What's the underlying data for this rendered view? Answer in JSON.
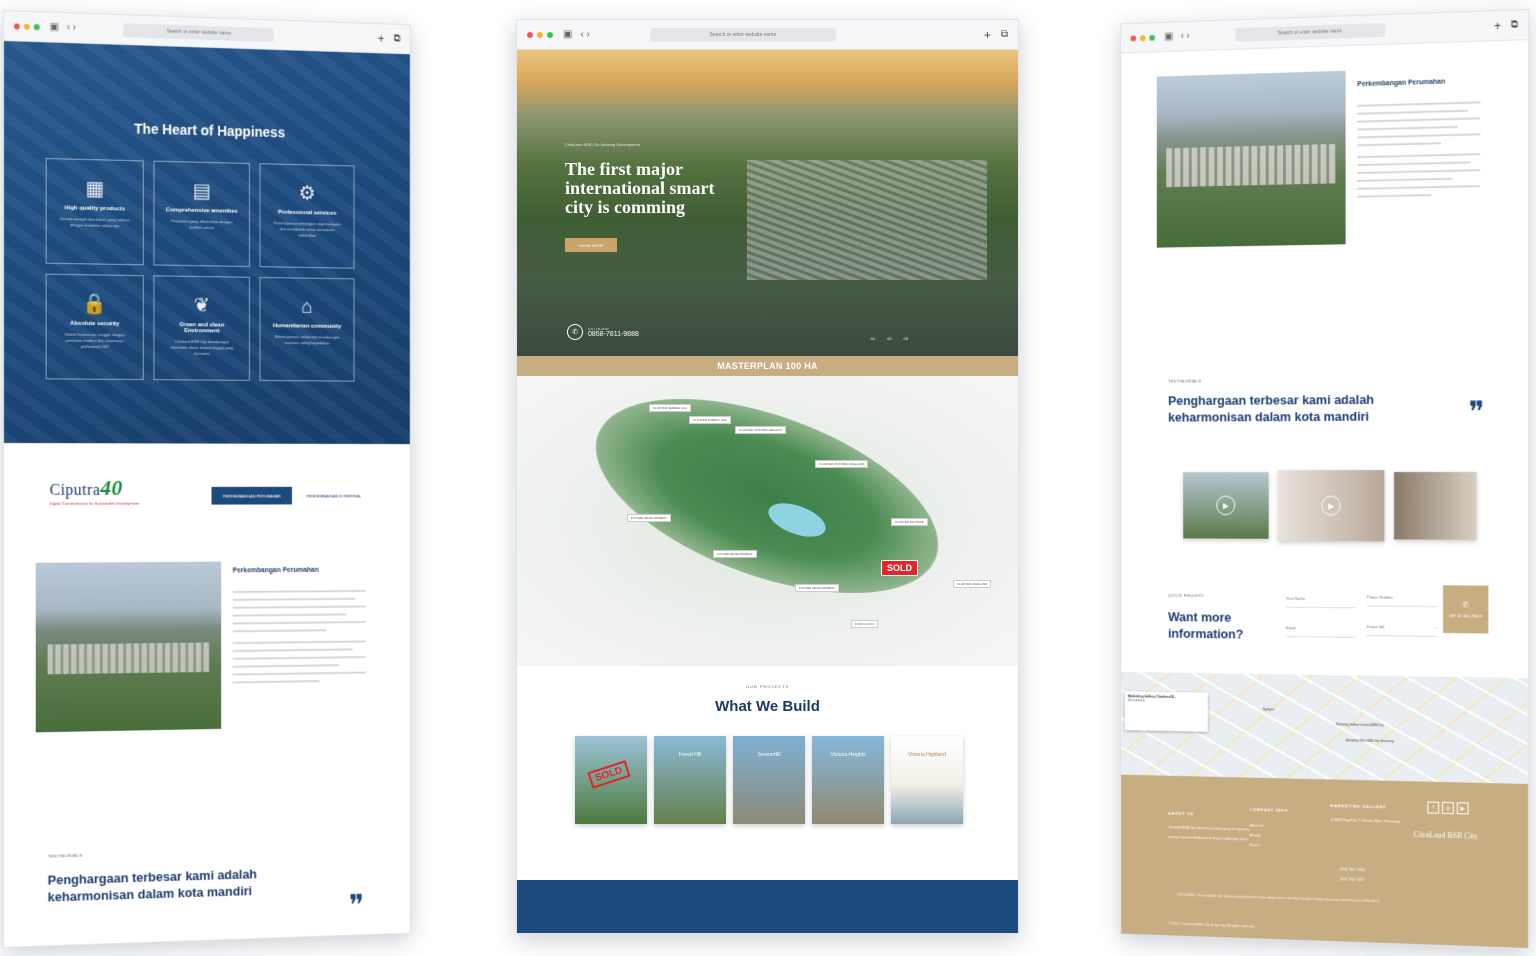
{
  "browser": {
    "url_placeholder": "Search or enter website name",
    "new_tab": "+",
    "copy": "⧉"
  },
  "left": {
    "hero_title": "The Heart of Happiness",
    "features": [
      {
        "icon": "building-icon",
        "glyph": "▦",
        "title": "High quality products",
        "desc": "Desain menarik dan kokoh yang selaras dengan arsitektur sekitarnya"
      },
      {
        "icon": "amenities-icon",
        "glyph": "▤",
        "title": "Comprehensive amenities",
        "desc": "Prasarana yang dibutuhkan dengan fasilitas umum"
      },
      {
        "icon": "service-icon",
        "glyph": "⚙",
        "title": "Professional services",
        "desc": "Pusat layanan pelanggan siap melayani dan membantu untuk memenuhi kebutuhan"
      },
      {
        "icon": "lock-icon",
        "glyph": "🔒",
        "title": "Absolute security",
        "desc": "Sistem keamanan canggih dengan peralatan modern dan keamanan profesional 24/7"
      },
      {
        "icon": "leaf-icon",
        "glyph": "❦",
        "title": "Green and clean Environment",
        "desc": "Citraland BSB City membangun ekosistem dasar tempat tinggal yang harmonis"
      },
      {
        "icon": "community-icon",
        "glyph": "⌂",
        "title": "Humanitarian community",
        "desc": "Keberagaman, solidaritas membangun suasana saling kepedulian"
      }
    ],
    "logo_text": "Ciputra",
    "logo_num": "40",
    "logo_tagline": "Digital Transformation for Sustainable Development",
    "tab_active": "PERKEMBANGAN PERUMAHAN",
    "tab_other": "PERKEMBANGAN KOMERSIAL",
    "section_title": "Perkembangan Perumahan",
    "testimonial_label": "TESTIMONIALS",
    "testimonial_quote": "Penghargaan terbesar kami adalah keharmonisan dalam kota mandiri"
  },
  "center": {
    "hero_sub": "CitraLand BSB City Housing Development",
    "hero_title": "The first major international smart city is comming",
    "hero_button": "KNOW MORE",
    "phone_label": "CALL US NOW",
    "phone": "0858-7811-9888",
    "pager": [
      "01",
      "02",
      "03"
    ],
    "masterplan": "MASTERPLAN 100 HA",
    "sold": "SOLD",
    "map_labels": [
      "CLUSTER SERENE HILL",
      "CLUSTER FOREST HILL",
      "CLUSTER VICTORIA HEIGHTS",
      "CLUSTER VICTORIA HIGHLAND",
      "FUTURE DEVELOPMENT",
      "CLUSTER SKYPARK",
      "FUTURE DEVELOPMENT",
      "FUTURE DEVELOPMENT",
      "CLUSTER HIGHLAND",
      "FOOD & FUN"
    ],
    "projects_label": "OUR PROJECTS",
    "projects_title": "What We Build",
    "projects": [
      "",
      "Forest Hill",
      "SerenoHill",
      "Victoria Heights",
      "Victoria Highland"
    ],
    "sold_stamp": "SOLD"
  },
  "right": {
    "section_title": "Perkembangan Perumahan",
    "testimonial_label": "TESTIMONIALS",
    "testimonial_quote": "Penghargaan terbesar kami adalah keharmonisan dalam kota mandiri",
    "enquiry_label": "QUICK ENQUIRY",
    "enquiry_title": "Want more information?",
    "fields": {
      "name": "Your Name",
      "phone": "Phone Number",
      "email": "Email",
      "cluster": "Forest Hill"
    },
    "cta": "GET A CALL BACK",
    "map_card_title": "Marketing Gallery Citraland B...",
    "map_card_rating": "4.3 ★★★★★",
    "map_places": [
      "Marketing Gallery Citraland BSB City",
      "Marketing Office BSB City Semarang",
      "Ngaliyan"
    ],
    "footer": {
      "about_h": "ABOUT US",
      "about_t": "Citraland BSB City Semarang hunian yang mengusung konsep harmoni kehidupan di tengah lingkungan hijau",
      "company_h": "COMPANY INFO",
      "company_links": [
        "About Us",
        "Awards",
        "Project"
      ],
      "gallery_h": "MARKETING GALLERY",
      "gallery_t": "Jl. BSB Raya Kav. 7 Jatisari, Mijen, Semarang",
      "phone1": "(024) 7667 5008",
      "phone2": "(024) 7667 5077",
      "social": [
        "f",
        "◎",
        "▶"
      ],
      "logo": "CitraLand BSB City",
      "disclaimer": "DISCLAIMER : Semua gambar dan informasi yang ditampilkan hanya sebagai ilustrasi dan dapat berubah sewaktu-waktu tanpa pemberitahuan terlebih dahulu",
      "copyright": "© 2022 - Citraland BSB City Semarang. All rights reserved"
    }
  },
  "colors": {
    "navy": "#1e4b7d",
    "gold": "#c6ad82",
    "sold_red": "#e0262a"
  }
}
